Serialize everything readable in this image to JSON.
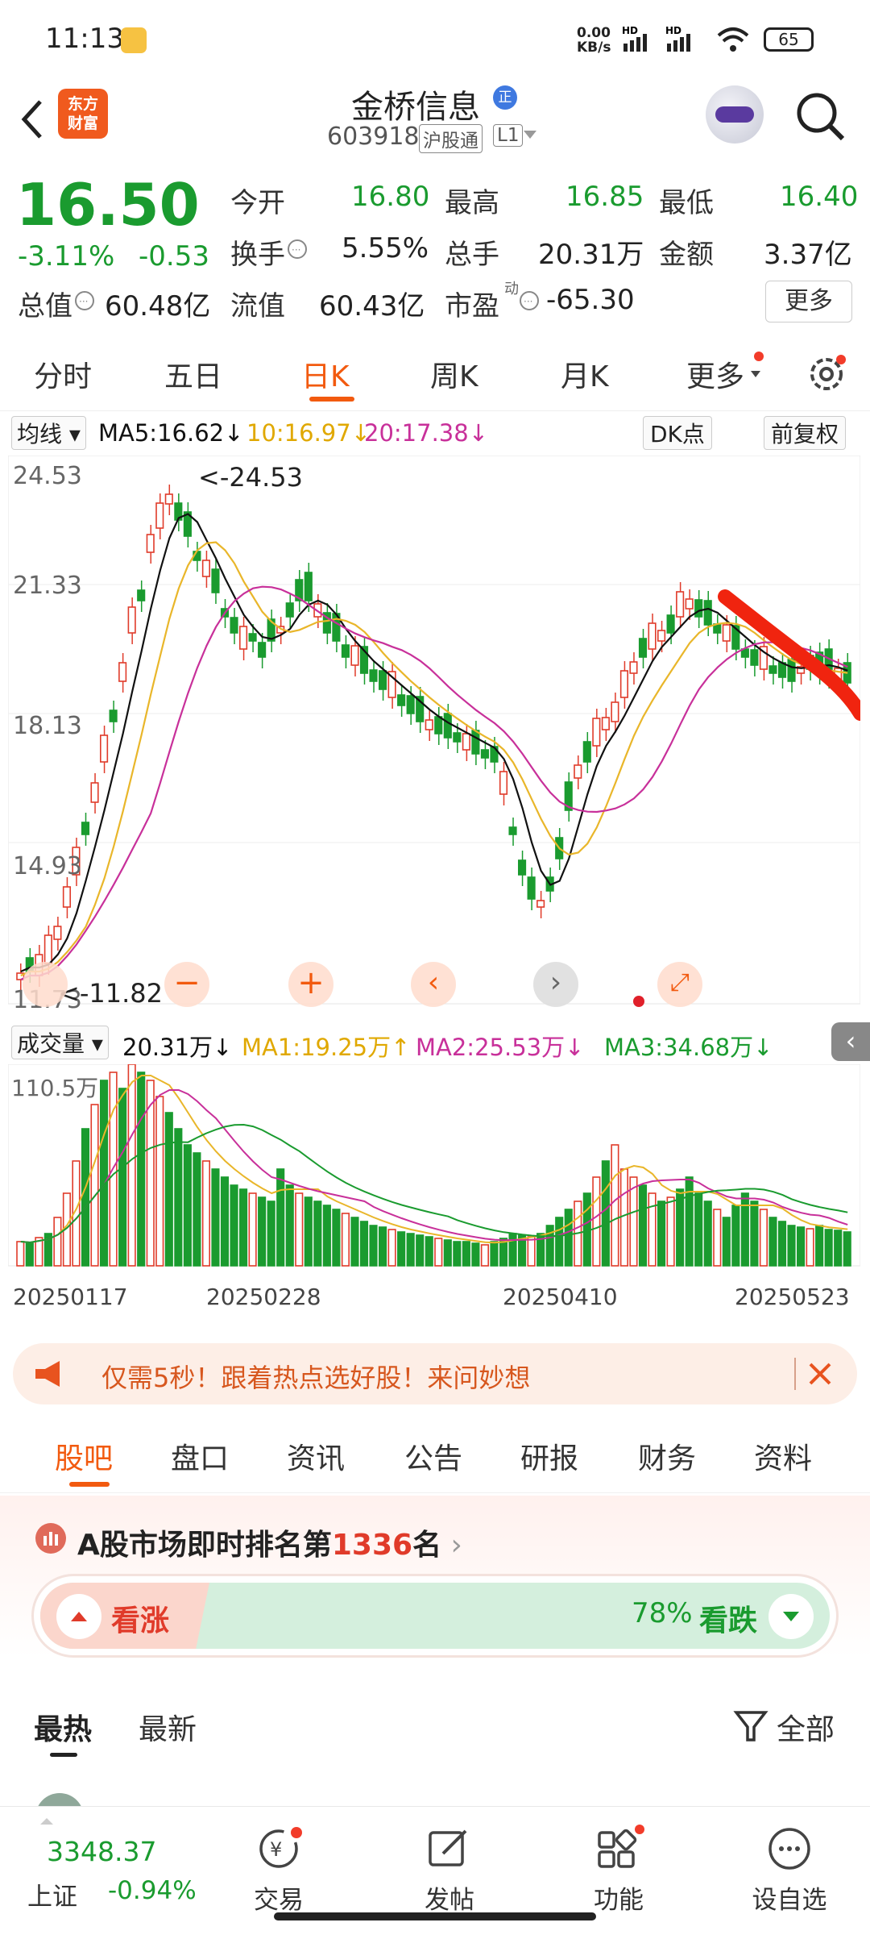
{
  "status_bar": {
    "time": "11:13",
    "net_speed_top": "0.00",
    "net_speed_bottom": "KB/s",
    "battery": "65",
    "hd1": "HD",
    "hd2": "HD"
  },
  "header": {
    "brand_badge": "东方\n财富",
    "stock_name": "金桥信息",
    "stock_code": "603918",
    "tag_hgt": "沪股通",
    "tag_level": "L1",
    "title_badge": "正"
  },
  "quote": {
    "price": "16.50",
    "change_pct": "-3.11%",
    "change": "-0.53",
    "open_label": "今开",
    "open": "16.80",
    "high_label": "最高",
    "high": "16.85",
    "low_label": "最低",
    "low": "16.40",
    "turnover_label": "换手",
    "turnover": "5.55%",
    "volume_label": "总手",
    "volume": "20.31万",
    "amount_label": "金额",
    "amount": "3.37亿",
    "mcap_label": "总值",
    "mcap": "60.48亿",
    "float_label": "流值",
    "float": "60.43亿",
    "pe_label": "市盈",
    "pe_sup": "动",
    "pe": "-65.30",
    "more": "更多"
  },
  "tabs": [
    "分时",
    "五日",
    "日K",
    "周K",
    "月K",
    "更多"
  ],
  "ma_line": {
    "selector": "均线",
    "ma5": "MA5:16.62↓",
    "ma10": "10:16.97↓",
    "ma20": "20:17.38↓",
    "dk": "DK点",
    "fq": "前复权"
  },
  "chart_axis": {
    "y1": "24.53",
    "y2": "21.33",
    "y3": "18.13",
    "y4": "14.93",
    "y5": "11.73",
    "max_label": "<-24.53",
    "min_label": "<-11.82"
  },
  "vol_line": {
    "selector": "成交量",
    "vol": "20.31万↓",
    "ma1": "MA1:19.25万↑",
    "ma2": "MA2:25.53万↓",
    "ma3": "MA3:34.68万↓",
    "ymax": "110.5万"
  },
  "dates": [
    "20250117",
    "20250228",
    "20250410",
    "20250523"
  ],
  "banner": {
    "text": "仅需5秒！跟着热点选好股！来问妙想"
  },
  "subtabs": [
    "股吧",
    "盘口",
    "资讯",
    "公告",
    "研报",
    "财务",
    "资料"
  ],
  "rank": {
    "text_pre": "A股市场即时排名第",
    "rank": "1336",
    "text_post": "名",
    "rise_label": "看涨",
    "fall_pct": "78%",
    "fall_label": "看跌"
  },
  "feed": {
    "hot": "最热",
    "new": "最新",
    "filter": "全部"
  },
  "bottom": {
    "index_value": "3348.37",
    "index_name": "上证",
    "index_change": "-0.94%",
    "trade": "交易",
    "post": "发帖",
    "func": "功能",
    "watch": "设自选"
  },
  "colors": {
    "up": "#e03b2a",
    "down": "#1a9b2f",
    "ma5": "#111111",
    "ma10": "#e9b62a",
    "ma20": "#c8309a",
    "accent": "#f25a0f"
  },
  "chart_data": {
    "type": "candlestick",
    "title": "",
    "y_ticks": [
      24.53,
      21.33,
      18.13,
      14.93,
      11.73
    ],
    "ylim": [
      11.73,
      24.53
    ],
    "x_ticks": [
      "20250117",
      "20250228",
      "20250410",
      "20250523"
    ],
    "annotations": [
      "<-24.53",
      "<-11.82"
    ],
    "vol_ymax": "110.5万"
  }
}
